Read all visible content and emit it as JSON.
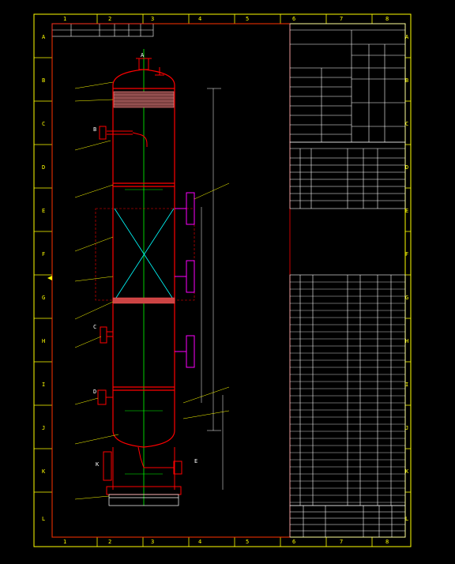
{
  "colors": {
    "background": "#000000",
    "frame": "#ffff00",
    "vessel": "#ff0000",
    "centerline": "#00ff00",
    "annotation": "#ffffff",
    "nozzle": "#ff00ff",
    "table_line": "#ffffff"
  },
  "grid": {
    "columns": [
      "1",
      "2",
      "3",
      "4",
      "5",
      "6",
      "7",
      "8"
    ],
    "rows": [
      "A",
      "B",
      "C",
      "D",
      "E",
      "F",
      "G",
      "H",
      "I",
      "J",
      "K",
      "L"
    ]
  },
  "nozzle_callouts": [
    "A",
    "B",
    "C",
    "D",
    "K",
    "E"
  ]
}
